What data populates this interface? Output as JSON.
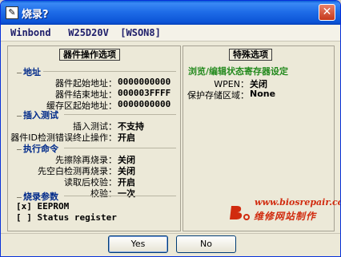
{
  "window": {
    "title": "烧录?",
    "close_glyph": "✕"
  },
  "device": {
    "name": "Winbond   W25D20V  [WSON8]"
  },
  "left_panel": {
    "title": "器件操作选项",
    "sections": {
      "address": {
        "label": "地址",
        "rows": [
          {
            "key": "器件起始地址：",
            "value": "0000000000"
          },
          {
            "key": "器件结束地址：",
            "value": "000003FFFF"
          },
          {
            "key": "缓存区起始地址：",
            "value": "0000000000"
          }
        ]
      },
      "insert_test": {
        "label": "插入测试",
        "rows": [
          {
            "key": "插入测试：",
            "value": "不支持"
          },
          {
            "key": "器件ID检测错误终止操作：",
            "value": "开启"
          }
        ]
      },
      "exec_cmd": {
        "label": "执行命令",
        "rows": [
          {
            "key": "先擦除再烧录：",
            "value": "关闭"
          },
          {
            "key": "先空白检测再烧录：",
            "value": "关闭"
          },
          {
            "key": "读取后校验：",
            "value": "开启"
          },
          {
            "key": "校验：",
            "value": "一次"
          }
        ]
      },
      "burn_params": {
        "label": "烧录参数",
        "checks": [
          {
            "box": "[x]",
            "label": "EEPROM"
          },
          {
            "box": "[ ]",
            "label": "Status register"
          }
        ]
      }
    }
  },
  "right_panel": {
    "title": "特殊选项",
    "subtitle": "浏览/编辑状态寄存器设定",
    "rows": [
      {
        "key": "WPEN：",
        "value": "关闭"
      },
      {
        "key": "保护存储区域：",
        "value": "None"
      }
    ]
  },
  "watermark": {
    "url": "www.biosrepair.com",
    "text": "维修网站制作"
  },
  "buttons": {
    "yes": "Yes",
    "no": "No"
  },
  "colors": {
    "title_bar": "#1f6de8",
    "section_label": "#002a8a",
    "green_heading": "#248a1e",
    "watermark": "#d12b0f"
  }
}
